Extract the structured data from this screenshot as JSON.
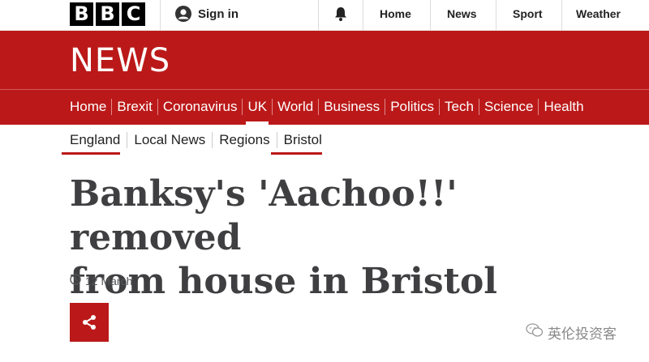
{
  "header": {
    "logo_letters": [
      "B",
      "B",
      "C"
    ],
    "signin_label": "Sign in",
    "nav": [
      "Home",
      "News",
      "Sport",
      "Weather"
    ]
  },
  "news_brand": "NEWS",
  "main_nav": {
    "items": [
      "Home",
      "Brexit",
      "Coronavirus",
      "UK",
      "World",
      "Business",
      "Politics",
      "Tech",
      "Science",
      "Health"
    ],
    "active": "UK"
  },
  "sub_nav": {
    "items": [
      "England",
      "Local News",
      "Regions",
      "Bristol"
    ],
    "active": [
      "England",
      "Bristol"
    ]
  },
  "article": {
    "headline_line1": "Banksy's 'Aachoo!!' removed",
    "headline_line2": "from house in Bristol",
    "date": "12 March"
  },
  "watermark": "英伦投资客",
  "icons": [
    "bbc-logo",
    "user-icon",
    "bell-icon",
    "clock-icon",
    "share-icon",
    "wechat-icon"
  ],
  "colors": {
    "brand_red": "#bb1919",
    "headline": "#3f3f42"
  }
}
